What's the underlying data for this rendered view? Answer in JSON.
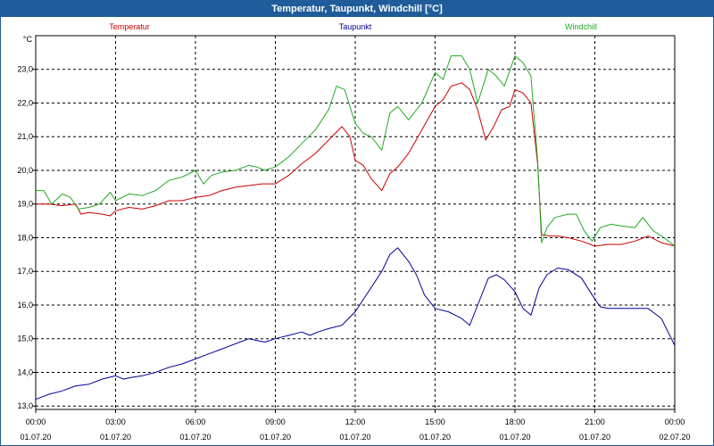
{
  "window": {
    "title": "Temperatur, Taupunkt, Windchill [°C]"
  },
  "chart_data": {
    "type": "line",
    "title": "Temperatur, Taupunkt, Windchill [°C]",
    "ylabel": "°C",
    "ylim": [
      12.9,
      24.0
    ],
    "xlim_hours": [
      0,
      24
    ],
    "y_ticks": [
      "13,0",
      "14,0",
      "15,0",
      "16,0",
      "17,0",
      "18,0",
      "19,0",
      "20,0",
      "21,0",
      "22,0",
      "23,0"
    ],
    "x_ticks": [
      {
        "time": "00:00",
        "date": "01.07.20"
      },
      {
        "time": "03:00",
        "date": "01.07.20"
      },
      {
        "time": "06:00",
        "date": "01.07.20"
      },
      {
        "time": "09:00",
        "date": "01.07.20"
      },
      {
        "time": "12:00",
        "date": "01.07.20"
      },
      {
        "time": "15:00",
        "date": "01.07.20"
      },
      {
        "time": "18:00",
        "date": "01.07.20"
      },
      {
        "time": "21:00",
        "date": "01.07.20"
      },
      {
        "time": "00:00",
        "date": "02.07.20"
      }
    ],
    "grid": true,
    "legend_position": "top",
    "series": [
      {
        "name": "Temperatur",
        "color": "#cc0000",
        "points": [
          [
            0,
            19.0
          ],
          [
            0.5,
            19.0
          ],
          [
            1.0,
            18.95
          ],
          [
            1.5,
            19.0
          ],
          [
            1.7,
            18.7
          ],
          [
            2.0,
            18.75
          ],
          [
            2.5,
            18.7
          ],
          [
            2.8,
            18.65
          ],
          [
            3.0,
            18.8
          ],
          [
            3.5,
            18.9
          ],
          [
            4.0,
            18.85
          ],
          [
            4.5,
            18.95
          ],
          [
            5.0,
            19.1
          ],
          [
            5.5,
            19.1
          ],
          [
            6.0,
            19.2
          ],
          [
            6.5,
            19.25
          ],
          [
            7.0,
            19.4
          ],
          [
            7.5,
            19.5
          ],
          [
            8.0,
            19.55
          ],
          [
            8.5,
            19.6
          ],
          [
            9.0,
            19.6
          ],
          [
            9.5,
            19.85
          ],
          [
            10.0,
            20.2
          ],
          [
            10.5,
            20.5
          ],
          [
            11.0,
            20.9
          ],
          [
            11.5,
            21.3
          ],
          [
            11.8,
            21.0
          ],
          [
            12.0,
            20.3
          ],
          [
            12.3,
            20.15
          ],
          [
            12.6,
            19.75
          ],
          [
            13.0,
            19.4
          ],
          [
            13.3,
            19.9
          ],
          [
            13.6,
            20.1
          ],
          [
            14.0,
            20.5
          ],
          [
            14.5,
            21.2
          ],
          [
            15.0,
            21.9
          ],
          [
            15.3,
            22.1
          ],
          [
            15.6,
            22.5
          ],
          [
            16.0,
            22.6
          ],
          [
            16.3,
            22.4
          ],
          [
            16.6,
            21.8
          ],
          [
            16.9,
            20.9
          ],
          [
            17.2,
            21.3
          ],
          [
            17.5,
            21.8
          ],
          [
            17.8,
            21.9
          ],
          [
            18.0,
            22.4
          ],
          [
            18.3,
            22.3
          ],
          [
            18.6,
            22.0
          ],
          [
            18.85,
            20.2
          ],
          [
            19.0,
            18.1
          ],
          [
            19.3,
            18.05
          ],
          [
            19.6,
            18.05
          ],
          [
            20.0,
            18.0
          ],
          [
            20.5,
            17.9
          ],
          [
            21.0,
            17.75
          ],
          [
            21.5,
            17.8
          ],
          [
            22.0,
            17.8
          ],
          [
            22.5,
            17.9
          ],
          [
            23.0,
            18.05
          ],
          [
            23.5,
            17.85
          ],
          [
            24.0,
            17.75
          ]
        ]
      },
      {
        "name": "Taupunkt",
        "color": "#000099",
        "points": [
          [
            0,
            13.2
          ],
          [
            0.5,
            13.35
          ],
          [
            1.0,
            13.45
          ],
          [
            1.5,
            13.6
          ],
          [
            2.0,
            13.65
          ],
          [
            2.5,
            13.8
          ],
          [
            3.0,
            13.9
          ],
          [
            3.3,
            13.8
          ],
          [
            3.6,
            13.85
          ],
          [
            4.0,
            13.9
          ],
          [
            4.5,
            14.0
          ],
          [
            5.0,
            14.15
          ],
          [
            5.5,
            14.25
          ],
          [
            6.0,
            14.4
          ],
          [
            6.5,
            14.55
          ],
          [
            7.0,
            14.7
          ],
          [
            7.5,
            14.85
          ],
          [
            8.0,
            15.0
          ],
          [
            8.3,
            14.95
          ],
          [
            8.6,
            14.9
          ],
          [
            9.0,
            15.0
          ],
          [
            9.5,
            15.1
          ],
          [
            10.0,
            15.2
          ],
          [
            10.3,
            15.1
          ],
          [
            10.6,
            15.2
          ],
          [
            11.0,
            15.3
          ],
          [
            11.5,
            15.4
          ],
          [
            12.0,
            15.8
          ],
          [
            12.5,
            16.4
          ],
          [
            13.0,
            17.0
          ],
          [
            13.3,
            17.5
          ],
          [
            13.6,
            17.7
          ],
          [
            14.0,
            17.3
          ],
          [
            14.3,
            16.9
          ],
          [
            14.6,
            16.3
          ],
          [
            15.0,
            15.9
          ],
          [
            15.5,
            15.8
          ],
          [
            16.0,
            15.6
          ],
          [
            16.3,
            15.4
          ],
          [
            16.6,
            16.0
          ],
          [
            17.0,
            16.8
          ],
          [
            17.3,
            16.9
          ],
          [
            17.6,
            16.75
          ],
          [
            18.0,
            16.4
          ],
          [
            18.3,
            15.9
          ],
          [
            18.6,
            15.7
          ],
          [
            18.9,
            16.5
          ],
          [
            19.2,
            16.9
          ],
          [
            19.6,
            17.1
          ],
          [
            20.0,
            17.05
          ],
          [
            20.5,
            16.8
          ],
          [
            20.9,
            16.3
          ],
          [
            21.2,
            15.95
          ],
          [
            21.5,
            15.9
          ],
          [
            22.0,
            15.9
          ],
          [
            22.5,
            15.9
          ],
          [
            23.0,
            15.9
          ],
          [
            23.5,
            15.6
          ],
          [
            24.0,
            14.8
          ]
        ]
      },
      {
        "name": "Windchill",
        "color": "#22aa22",
        "points": [
          [
            0,
            19.4
          ],
          [
            0.3,
            19.4
          ],
          [
            0.6,
            19.0
          ],
          [
            1.0,
            19.3
          ],
          [
            1.3,
            19.2
          ],
          [
            1.6,
            18.85
          ],
          [
            2.0,
            18.9
          ],
          [
            2.4,
            19.0
          ],
          [
            2.8,
            19.35
          ],
          [
            3.0,
            19.1
          ],
          [
            3.5,
            19.3
          ],
          [
            4.0,
            19.25
          ],
          [
            4.5,
            19.4
          ],
          [
            5.0,
            19.7
          ],
          [
            5.5,
            19.8
          ],
          [
            6.0,
            20.0
          ],
          [
            6.3,
            19.6
          ],
          [
            6.6,
            19.85
          ],
          [
            7.0,
            19.95
          ],
          [
            7.5,
            20.0
          ],
          [
            8.0,
            20.15
          ],
          [
            8.3,
            20.1
          ],
          [
            8.6,
            20.0
          ],
          [
            9.0,
            20.1
          ],
          [
            9.5,
            20.4
          ],
          [
            10.0,
            20.8
          ],
          [
            10.5,
            21.2
          ],
          [
            11.0,
            21.8
          ],
          [
            11.3,
            22.5
          ],
          [
            11.6,
            22.4
          ],
          [
            12.0,
            21.4
          ],
          [
            12.3,
            21.1
          ],
          [
            12.6,
            21.0
          ],
          [
            13.0,
            20.6
          ],
          [
            13.3,
            21.7
          ],
          [
            13.6,
            21.9
          ],
          [
            14.0,
            21.5
          ],
          [
            14.5,
            22.0
          ],
          [
            15.0,
            22.9
          ],
          [
            15.3,
            22.7
          ],
          [
            15.6,
            23.4
          ],
          [
            16.0,
            23.4
          ],
          [
            16.3,
            23.0
          ],
          [
            16.6,
            22.0
          ],
          [
            17.0,
            23.0
          ],
          [
            17.3,
            22.8
          ],
          [
            17.6,
            22.5
          ],
          [
            18.0,
            23.4
          ],
          [
            18.3,
            23.2
          ],
          [
            18.6,
            22.8
          ],
          [
            18.85,
            20.3
          ],
          [
            19.0,
            17.85
          ],
          [
            19.2,
            18.3
          ],
          [
            19.5,
            18.6
          ],
          [
            20.0,
            18.7
          ],
          [
            20.3,
            18.7
          ],
          [
            20.6,
            18.2
          ],
          [
            20.9,
            17.9
          ],
          [
            21.2,
            18.3
          ],
          [
            21.6,
            18.4
          ],
          [
            22.0,
            18.35
          ],
          [
            22.5,
            18.3
          ],
          [
            22.8,
            18.6
          ],
          [
            23.2,
            18.2
          ],
          [
            23.6,
            18.0
          ],
          [
            24.0,
            17.75
          ]
        ]
      }
    ]
  }
}
